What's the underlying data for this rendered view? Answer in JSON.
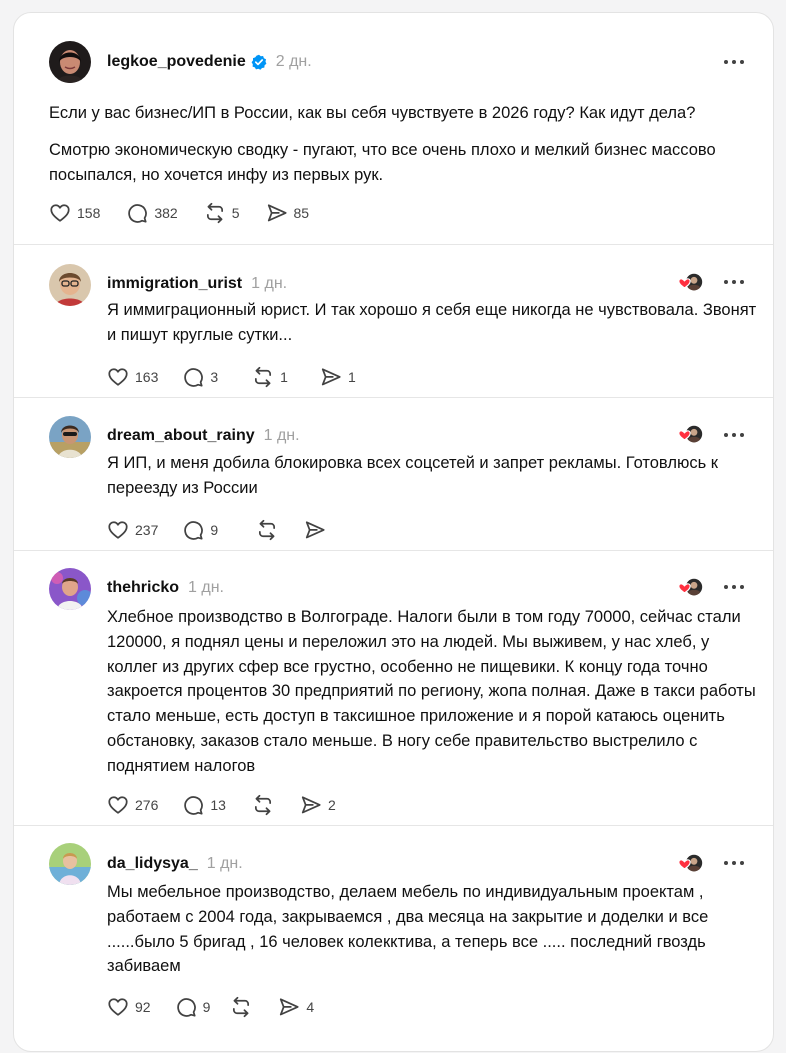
{
  "main_post": {
    "username": "legkoe_povedenie",
    "time": "2 дн.",
    "paragraph1": "Если у вас бизнес/ИП в России, как вы себя чувствуете в 2026 году? Как идут дела?",
    "paragraph2": "Смотрю экономическую сводку - пугают, что все очень плохо и мелкий бизнес массово посыпался, но хочется инфу из первых рук.",
    "likes": "158",
    "replies": "382",
    "reposts": "5",
    "shares": "85"
  },
  "replies": [
    {
      "username": "immigration_urist",
      "time": "1 дн.",
      "text": "Я иммиграционный юрист. И так хорошо я себя еще никогда не чувствовала. Звонят и пишут круглые сутки...",
      "likes": "163",
      "replies": "3",
      "reposts": "1",
      "shares": "1"
    },
    {
      "username": "dream_about_rainy",
      "time": "1 дн.",
      "text": "Я ИП, и меня добила блокировка всех соцсетей и запрет рекламы. Готовлюсь к переезду из России",
      "likes": "237",
      "replies": "9",
      "reposts": "",
      "shares": ""
    },
    {
      "username": "thehricko",
      "time": "1 дн.",
      "text": "Хлебное производство в Волгограде. Налоги были в том году 70000, сейчас стали 120000, я поднял цены и переложил это на людей. Мы выживем, у нас хлеб, у коллег из других сфер все грустно, особенно не пищевики. К концу года точно закроется процентов 30 предприятий по региону, жопа полная. Даже в такси работы стало меньше, есть доступ в таксишное приложение и я порой катаюсь оценить обстановку, заказов стало меньше. В ногу себе правительство выстрелило с поднятием налогов",
      "likes": "276",
      "replies": "13",
      "reposts": "",
      "shares": "2"
    },
    {
      "username": "da_lidysya_",
      "time": "1 дн.",
      "text": "Мы мебельное производство, делаем мебель по индивидуальным проектам , работаем с 2004 года, закрываемся , два месяца на закрытие и доделки и все ......было 5 бригад , 16 человек колекктива, а теперь все ..... последний гвоздь забиваем",
      "likes": "92",
      "replies": "9",
      "reposts": "",
      "shares": "4"
    }
  ],
  "colors": {
    "verified": "#0095f6",
    "liked_heart": "#ff3040",
    "icon": "#424242",
    "muted": "#a0a0a0"
  }
}
